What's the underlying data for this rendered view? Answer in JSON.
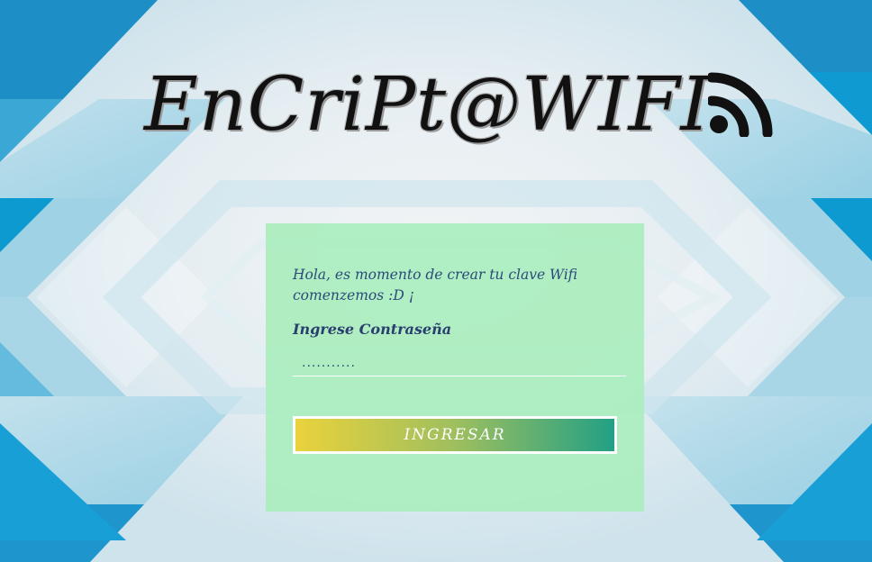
{
  "header": {
    "title": "EnCriPt@WIFI",
    "icon": "wifi-signal-icon"
  },
  "login_card": {
    "greeting": "Hola, es momento de crear tu clave Wifi comenzemos :D ¡",
    "password_label": "Ingrese Contraseña",
    "password_value": "...........",
    "submit_label": "INGRESAR"
  },
  "colors": {
    "card_background": "#aeeec0",
    "button_gradient_start": "#ead23c",
    "button_gradient_end": "#22a085",
    "text_blue": "#2b4a7a",
    "background_blue": "#1a93c4"
  }
}
